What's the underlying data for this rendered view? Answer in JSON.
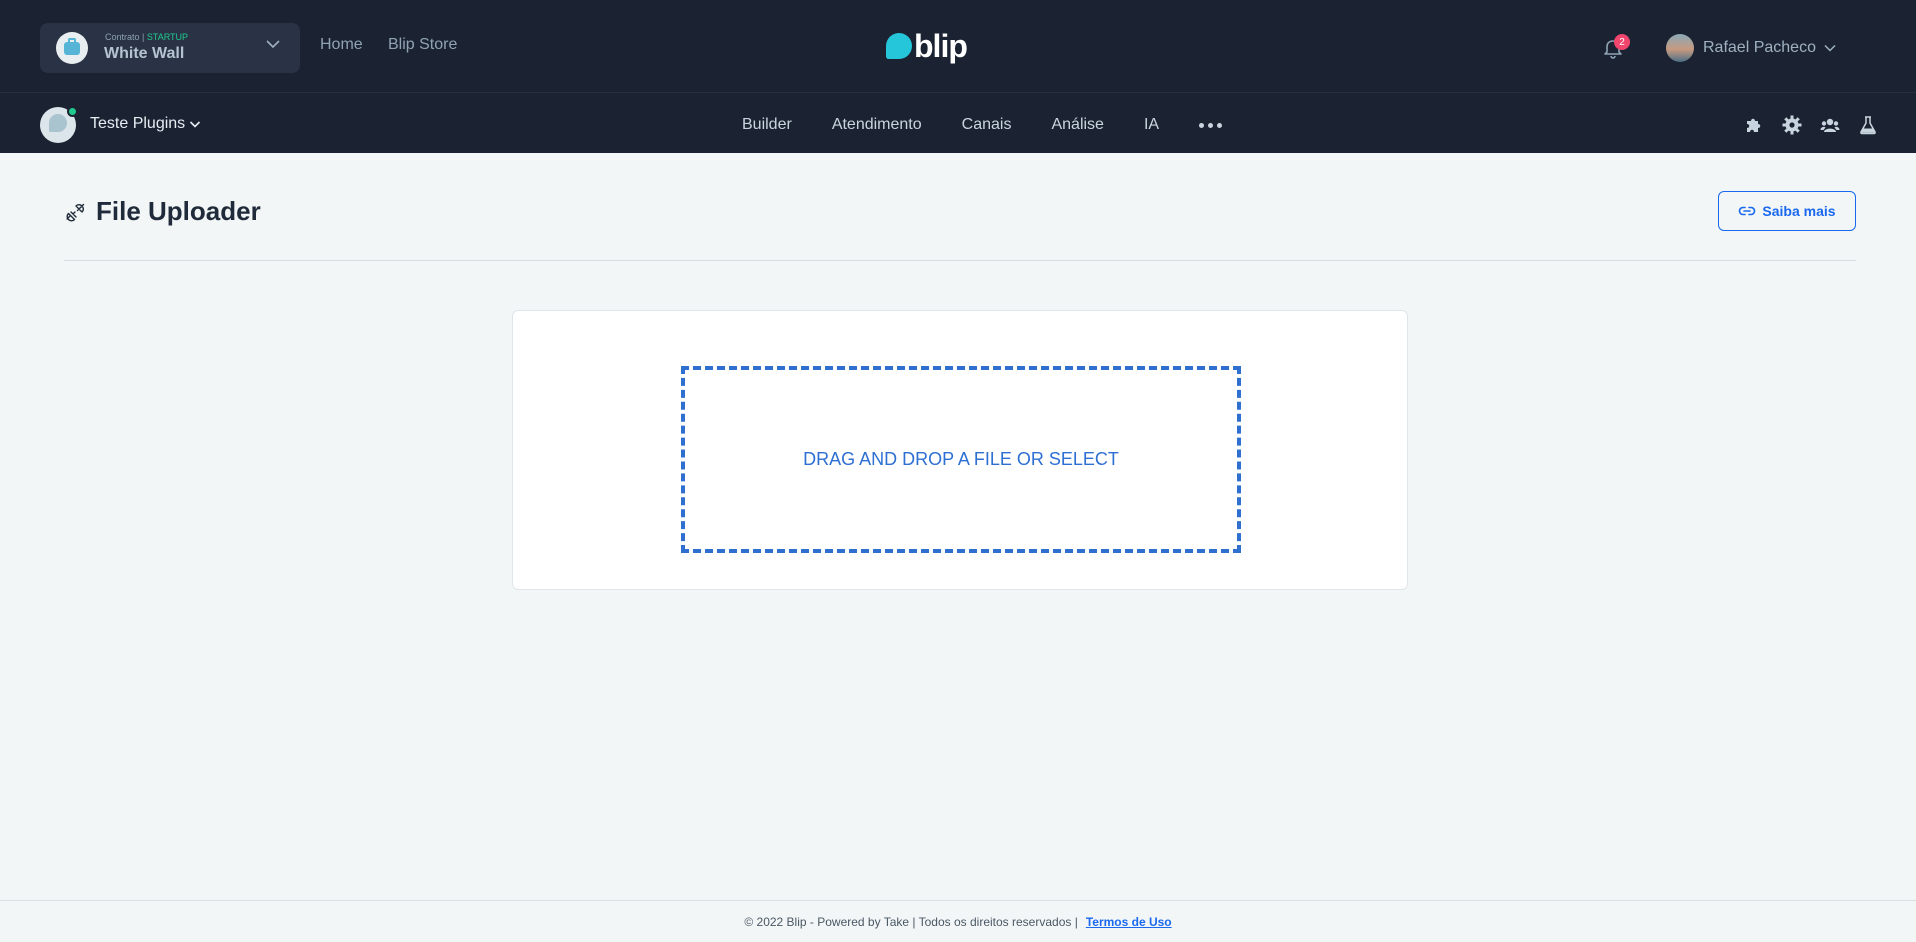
{
  "header": {
    "contract": {
      "type_label": "Contrato |",
      "plan": "STARTUP",
      "name": "White Wall",
      "icon": "briefcase-icon"
    },
    "nav": [
      {
        "label": "Home"
      },
      {
        "label": "Blip Store"
      }
    ],
    "logo_text": "blip",
    "notifications": {
      "count": "2",
      "icon": "bell-icon"
    },
    "user": {
      "name": "Rafael Pacheco"
    }
  },
  "subheader": {
    "bot_name": "Teste Plugins",
    "nav": [
      {
        "label": "Builder"
      },
      {
        "label": "Atendimento"
      },
      {
        "label": "Canais"
      },
      {
        "label": "Análise"
      },
      {
        "label": "IA"
      }
    ],
    "more_icon": "more-dots-icon",
    "tools": [
      "puzzle-icon",
      "gear-icon",
      "users-icon",
      "flask-icon"
    ]
  },
  "page": {
    "title": "File Uploader",
    "title_icon": "plugin-icon",
    "saiba_mais": "Saiba mais",
    "dropzone_text": "DRAG AND DROP A FILE OR SELECT"
  },
  "footer": {
    "copyright": "© 2022 Blip - Powered by Take | Todos os direitos reservados |",
    "terms": "Termos de Uso"
  },
  "colors": {
    "header_bg": "#1b2333",
    "page_bg": "#f3f6f6",
    "accent": "#1968f0",
    "logo_bubble": "#25c6d9",
    "online": "#20c98d",
    "badge": "#f0466d"
  }
}
